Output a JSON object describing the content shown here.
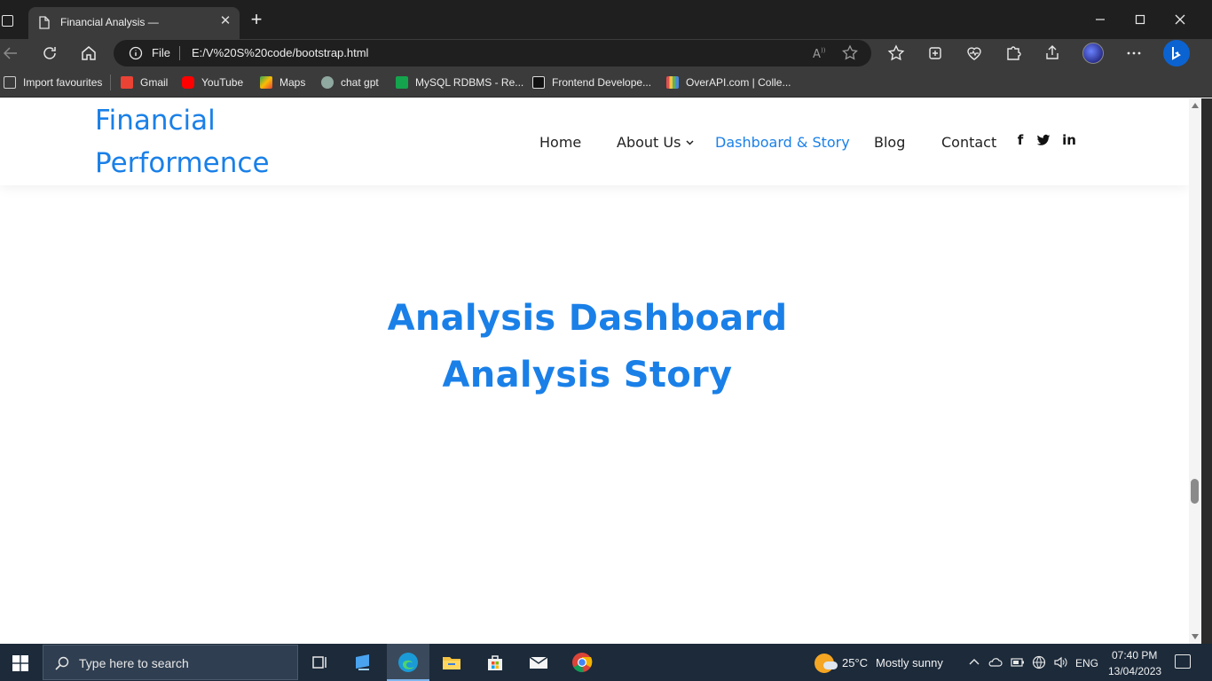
{
  "browser": {
    "tab_title": "Financial Analysis —",
    "address_scheme": "File",
    "address_url": "E:/V%20S%20code/bootstrap.html",
    "bookmarks": [
      {
        "label": "Import favourites",
        "color": "#cfcfcf"
      },
      {
        "label": "Gmail",
        "color": "#ea4335"
      },
      {
        "label": "YouTube",
        "color": "#ff0000"
      },
      {
        "label": "Maps",
        "color": "#34a853"
      },
      {
        "label": "chat gpt",
        "color": "#8fa8a0"
      },
      {
        "label": "MySQL RDBMS - Re...",
        "color": "#14a44d"
      },
      {
        "label": "Frontend Develope...",
        "color": "#111111"
      },
      {
        "label": "OverAPI.com | Colle...",
        "color": "#e05050"
      }
    ]
  },
  "site": {
    "logo_line1": "Financial",
    "logo_line2": "Performence",
    "nav": [
      {
        "label": "Home",
        "active": false
      },
      {
        "label": "About Us",
        "active": false
      },
      {
        "label": "Dashboard & Story",
        "active": true
      },
      {
        "label": "Blog",
        "active": false
      },
      {
        "label": "Contact",
        "active": false
      }
    ],
    "social": [
      {
        "icon": "facebook-icon",
        "glyph": "f"
      },
      {
        "icon": "twitter-icon",
        "glyph": "🐦"
      },
      {
        "icon": "linkedin-icon",
        "glyph": "in"
      }
    ],
    "hero_line1": "Analysis Dashboard",
    "hero_line2": "Analysis Story",
    "accent_color": "#1a80e8"
  },
  "taskbar": {
    "search_placeholder": "Type here to search",
    "weather_temp": "25°C",
    "weather_desc": "Mostly sunny",
    "language": "ENG",
    "time": "07:40 PM",
    "date": "13/04/2023"
  }
}
